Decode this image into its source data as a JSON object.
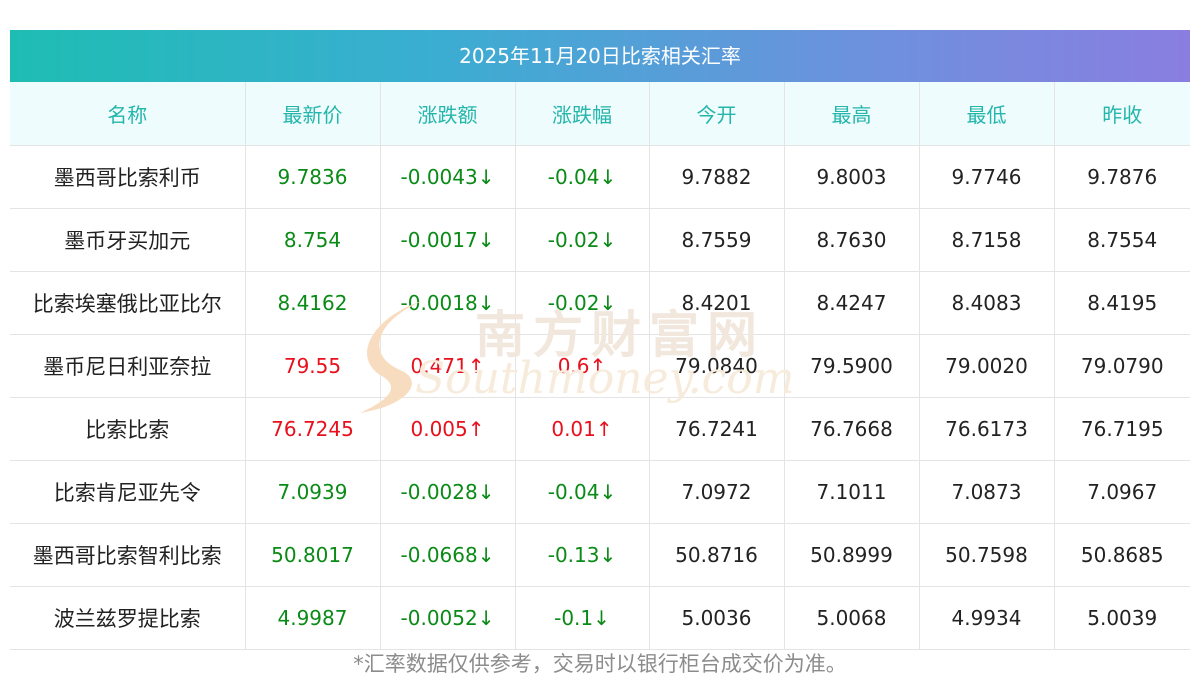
{
  "title": "2025年11月20日比索相关汇率",
  "headers": [
    "名称",
    "最新价",
    "涨跌额",
    "涨跌幅",
    "今开",
    "最高",
    "最低",
    "昨收"
  ],
  "rows": [
    {
      "name": "墨西哥比索利币",
      "latest": "9.7836",
      "change": "-0.0043↓",
      "pct": "-0.04↓",
      "open": "9.7882",
      "high": "9.8003",
      "low": "9.7746",
      "prev": "9.7876",
      "direction": "down"
    },
    {
      "name": "墨币牙买加元",
      "latest": "8.754",
      "change": "-0.0017↓",
      "pct": "-0.02↓",
      "open": "8.7559",
      "high": "8.7630",
      "low": "8.7158",
      "prev": "8.7554",
      "direction": "down"
    },
    {
      "name": "比索埃塞俄比亚比尔",
      "latest": "8.4162",
      "change": "-0.0018↓",
      "pct": "-0.02↓",
      "open": "8.4201",
      "high": "8.4247",
      "low": "8.4083",
      "prev": "8.4195",
      "direction": "down"
    },
    {
      "name": "墨币尼日利亚奈拉",
      "latest": "79.55",
      "change": "0.471↑",
      "pct": "0.6↑",
      "open": "79.0840",
      "high": "79.5900",
      "low": "79.0020",
      "prev": "79.0790",
      "direction": "up"
    },
    {
      "name": "比索比索",
      "latest": "76.7245",
      "change": "0.005↑",
      "pct": "0.01↑",
      "open": "76.7241",
      "high": "76.7668",
      "low": "76.6173",
      "prev": "76.7195",
      "direction": "up"
    },
    {
      "name": "比索肯尼亚先令",
      "latest": "7.0939",
      "change": "-0.0028↓",
      "pct": "-0.04↓",
      "open": "7.0972",
      "high": "7.1011",
      "low": "7.0873",
      "prev": "7.0967",
      "direction": "down"
    },
    {
      "name": "墨西哥比索智利比索",
      "latest": "50.8017",
      "change": "-0.0668↓",
      "pct": "-0.13↓",
      "open": "50.8716",
      "high": "50.8999",
      "low": "50.7598",
      "prev": "50.8685",
      "direction": "down"
    },
    {
      "name": "波兰兹罗提比索",
      "latest": "4.9987",
      "change": "-0.0052↓",
      "pct": "-0.1↓",
      "open": "5.0036",
      "high": "5.0068",
      "low": "4.9934",
      "prev": "5.0039",
      "direction": "down"
    }
  ],
  "footnote": "*汇率数据仅供参考，交易时以银行柜台成交价为准。",
  "watermark": {
    "cn": "南方财富网",
    "en": "Southmoney.com"
  },
  "colors": {
    "up": "#e8101c",
    "down": "#0a8a16",
    "header_text": "#24b5ab"
  }
}
